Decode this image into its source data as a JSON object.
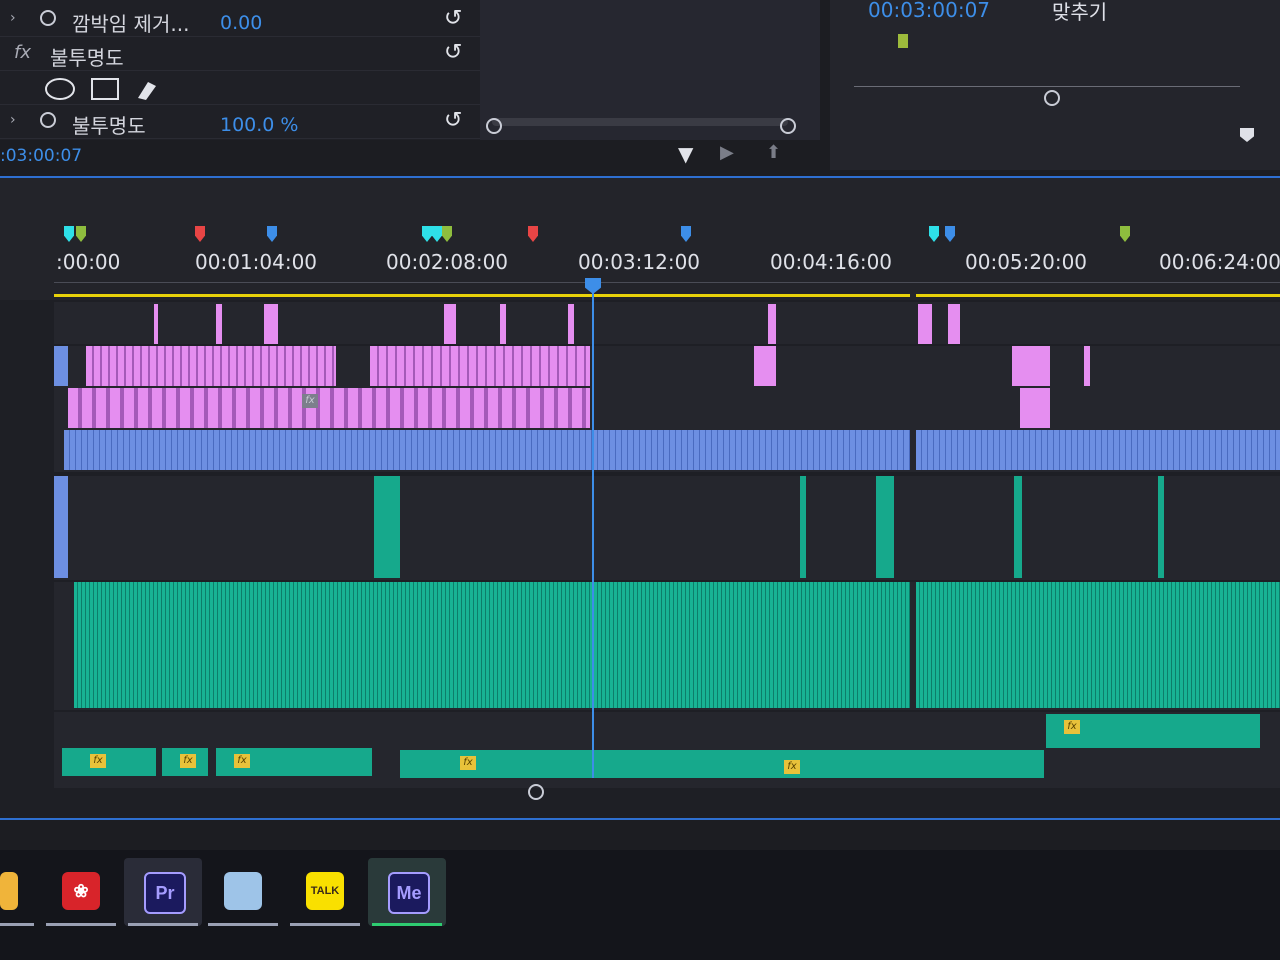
{
  "effect_controls": {
    "rows": [
      {
        "label": "깜박임 제거...",
        "value": "0.00"
      },
      {
        "label": "불투명도",
        "value": ""
      },
      {
        "label": "불투명도",
        "value": "100.0 %"
      }
    ],
    "fx_symbol": "fx",
    "current_time": ":03:00:07"
  },
  "program": {
    "timecode": "00:03:00:07",
    "fit_label": "맞추기"
  },
  "timeline": {
    "ruler_labels": [
      ":00:00",
      "00:01:04:00",
      "00:02:08:00",
      "00:03:12:00",
      "00:04:16:00",
      "00:05:20:00",
      "00:06:24:00"
    ]
  },
  "taskbar": {
    "apps": [
      {
        "name": "file-explorer",
        "label": ""
      },
      {
        "name": "acrobat",
        "label": ""
      },
      {
        "name": "premiere-pro",
        "label": "Pr"
      },
      {
        "name": "notes",
        "label": ""
      },
      {
        "name": "kakaotalk",
        "label": "TALK"
      },
      {
        "name": "media-encoder",
        "label": "Me"
      }
    ]
  },
  "colors": {
    "accent_blue": "#3d8ee8",
    "video_clip": "#e58ef0",
    "video_clip_blue": "#6d8fe2",
    "audio_clip": "#16a98c",
    "work_area": "#e8d20a"
  }
}
